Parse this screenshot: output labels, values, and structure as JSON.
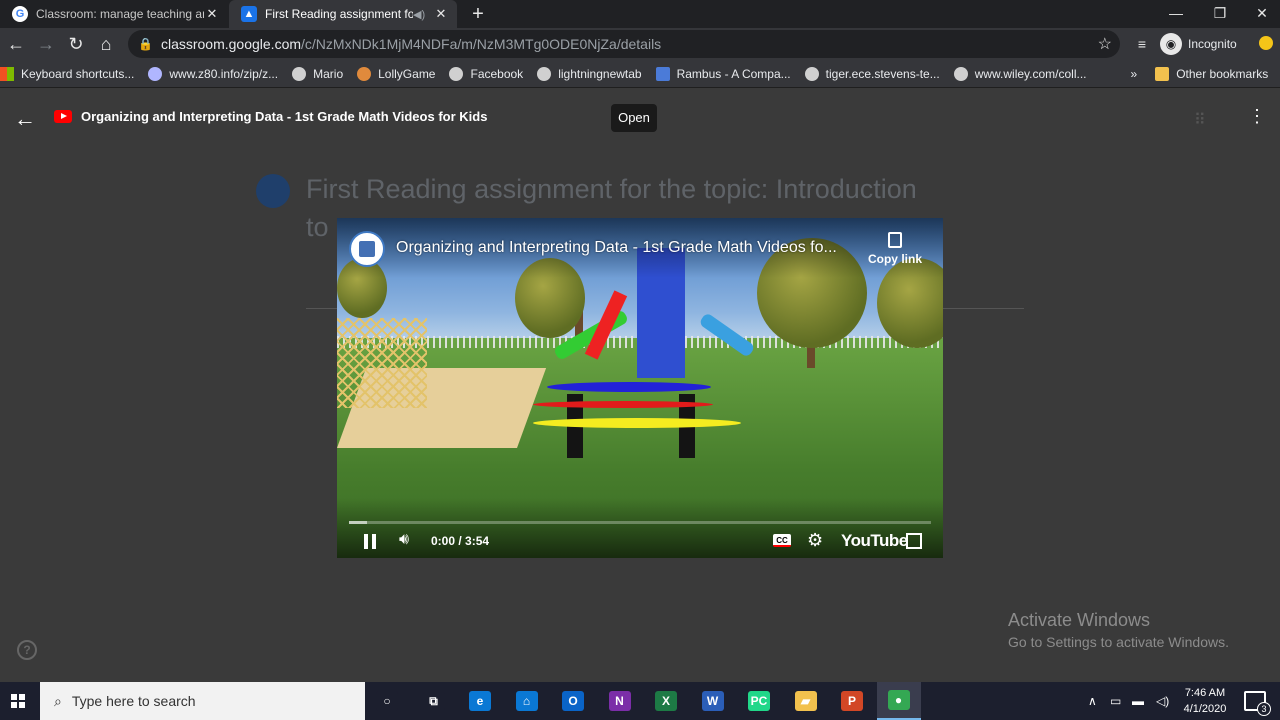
{
  "browser": {
    "tabs": [
      {
        "title": "Classroom: manage teaching anc",
        "favicon_color": "#4285f4",
        "active": false
      },
      {
        "title": "First Reading assignment for",
        "favicon_color": "#1a73e8",
        "active": true
      }
    ],
    "new_tab_symbol": "+",
    "window_controls": {
      "minimize": "—",
      "maximize": "❐",
      "close": "✕"
    },
    "url_host": "classroom.google.com",
    "url_path": "/c/NzMxNDk1MjM4NDFa/m/NzM3MTg0ODE0NjZa/details",
    "profile_label": "Incognito",
    "bookmarks": [
      {
        "label": "Keyboard shortcuts..."
      },
      {
        "label": "www.z80.info/zip/z..."
      },
      {
        "label": "Mario"
      },
      {
        "label": "LollyGame"
      },
      {
        "label": "Facebook"
      },
      {
        "label": "lightningnewtab"
      },
      {
        "label": "Rambus - A Compa..."
      },
      {
        "label": "tiger.ece.stevens-te..."
      },
      {
        "label": "www.wiley.com/coll..."
      }
    ],
    "bookmarks_more": "»",
    "other_bookmarks": "Other bookmarks"
  },
  "classroom": {
    "assignment_title_line1": "First Reading assignment for the topic: Introduction",
    "assignment_title_line2": "to"
  },
  "viewer": {
    "title": "Organizing and Interpreting Data - 1st Grade Math Videos for Kids",
    "open_label": "Open"
  },
  "player": {
    "overlay_title": "Organizing and Interpreting Data - 1st Grade Math Videos fo...",
    "copy_link_label": "Copy link",
    "time_display": "0:00 / 3:54",
    "played_fraction": 0.0,
    "cc_label": "CC",
    "brand_label": "YouTube"
  },
  "watermark": {
    "line1": "Activate Windows",
    "line2": "Go to Settings to activate Windows."
  },
  "taskbar": {
    "search_placeholder": "Type here to search",
    "apps": [
      {
        "name": "cortana",
        "letter": "○",
        "color": "#1c1f2e"
      },
      {
        "name": "task-view",
        "letter": "⧉",
        "color": "#1c1f2e"
      },
      {
        "name": "edge",
        "letter": "e",
        "color": "#0a78d4"
      },
      {
        "name": "store",
        "letter": "⌂",
        "color": "#0a78d4"
      },
      {
        "name": "outlook",
        "letter": "O",
        "color": "#0a64c8"
      },
      {
        "name": "onenote",
        "letter": "N",
        "color": "#7b2ea8"
      },
      {
        "name": "excel",
        "letter": "X",
        "color": "#1d7a45"
      },
      {
        "name": "word",
        "letter": "W",
        "color": "#2b5eb8"
      },
      {
        "name": "pycharm",
        "letter": "PC",
        "color": "#21d789"
      },
      {
        "name": "file-explorer",
        "letter": "▰",
        "color": "#f2c14e"
      },
      {
        "name": "powerpoint",
        "letter": "P",
        "color": "#d24726"
      },
      {
        "name": "chrome",
        "letter": "●",
        "color": "#34a853"
      }
    ],
    "time": "7:46 AM",
    "date": "4/1/2020",
    "notification_count": "3"
  }
}
